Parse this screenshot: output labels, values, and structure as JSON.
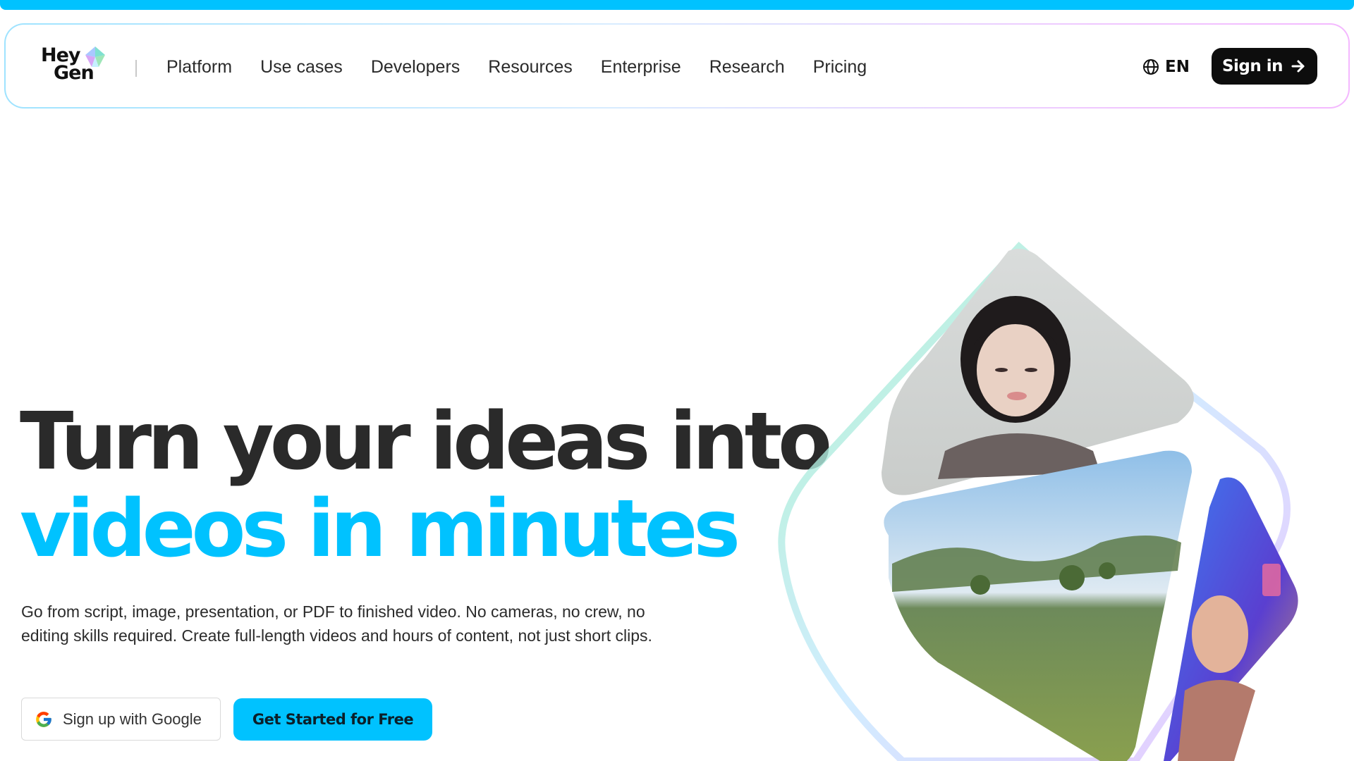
{
  "brand": {
    "logo_line1": "Hey",
    "logo_line2": "Gen",
    "accent_color": "#00c2ff"
  },
  "nav": {
    "links": [
      "Platform",
      "Use cases",
      "Developers",
      "Resources",
      "Enterprise",
      "Research",
      "Pricing"
    ],
    "language": "EN",
    "language_icon": "globe-icon",
    "signin_label": "Sign in",
    "signin_icon": "arrow-right-icon"
  },
  "hero": {
    "title_line1": "Turn your ideas into",
    "title_line2": "videos in minutes",
    "description": "Go from script, image, presentation, or PDF to finished video. No cameras, no crew, no editing skills required. Create full-length videos and hours of content, not just short clips.",
    "google_button_label": "Sign up with Google",
    "google_icon": "google-icon",
    "cta_label": "Get Started for Free"
  }
}
